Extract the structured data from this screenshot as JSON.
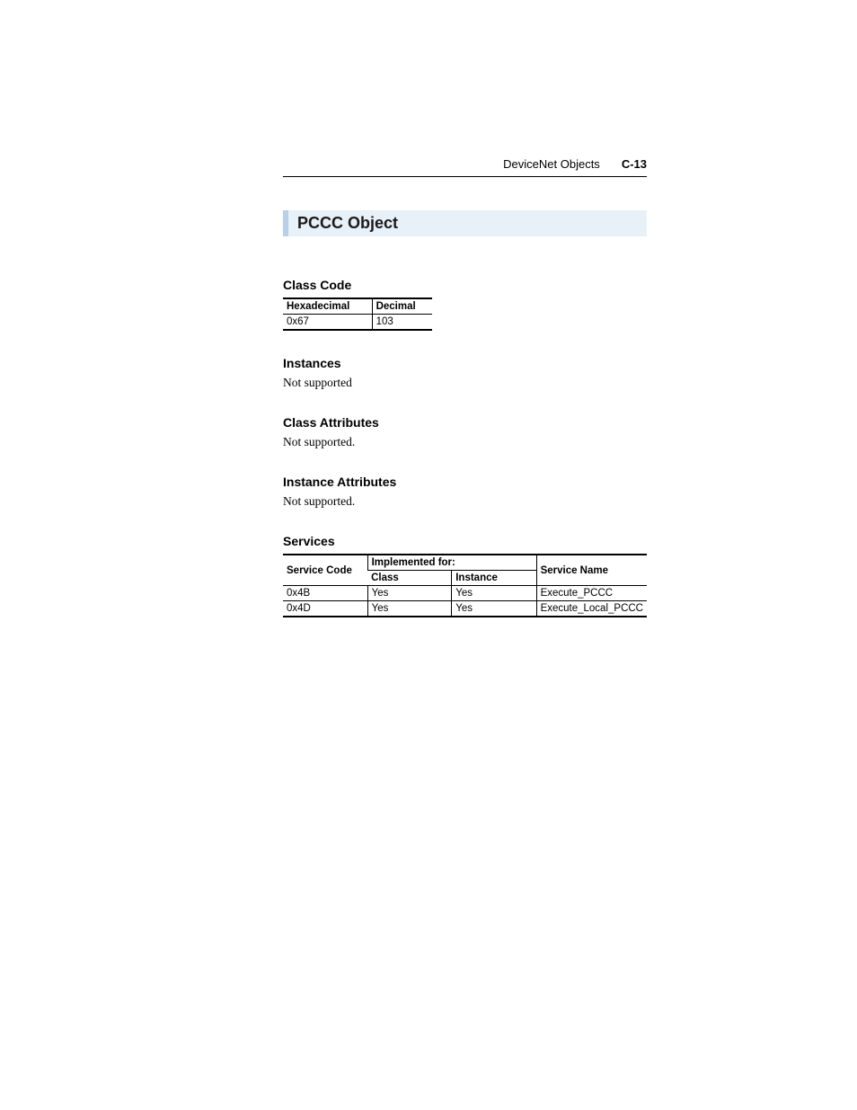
{
  "header": {
    "section_name": "DeviceNet Objects",
    "page_ref": "C-13"
  },
  "title": "PCCC Object",
  "class_code": {
    "heading": "Class Code",
    "columns": [
      "Hexadecimal",
      "Decimal"
    ],
    "row": [
      "0x67",
      "103"
    ]
  },
  "instances": {
    "heading": "Instances",
    "body": "Not supported"
  },
  "class_attributes": {
    "heading": "Class Attributes",
    "body": "Not supported."
  },
  "instance_attributes": {
    "heading": "Instance Attributes",
    "body": "Not supported."
  },
  "services": {
    "heading": "Services",
    "header_row1": {
      "service_code": "Service Code",
      "implemented_for": "Implemented for:",
      "service_name": "Service Name"
    },
    "header_row2": {
      "class": "Class",
      "instance": "Instance"
    },
    "rows": [
      {
        "code": "0x4B",
        "class": "Yes",
        "instance": "Yes",
        "name": "Execute_PCCC"
      },
      {
        "code": "0x4D",
        "class": "Yes",
        "instance": "Yes",
        "name": "Execute_Local_PCCC"
      }
    ]
  }
}
